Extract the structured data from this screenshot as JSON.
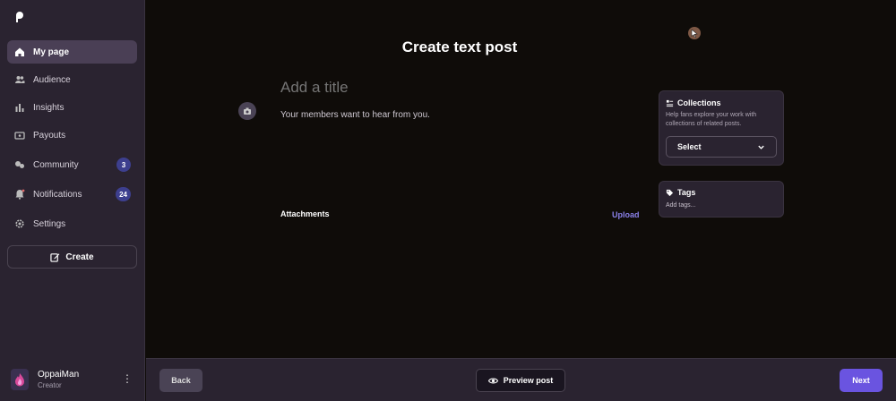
{
  "sidebar": {
    "items": [
      {
        "label": "My page",
        "icon": "home-icon",
        "active": true
      },
      {
        "label": "Audience",
        "icon": "people-icon"
      },
      {
        "label": "Insights",
        "icon": "bar-chart-icon"
      },
      {
        "label": "Payouts",
        "icon": "wallet-icon"
      },
      {
        "label": "Community",
        "icon": "community-icon",
        "badge": "3"
      },
      {
        "label": "Notifications",
        "icon": "bell-icon",
        "badge": "24"
      },
      {
        "label": "Settings",
        "icon": "gear-icon"
      }
    ],
    "create_label": "Create"
  },
  "profile": {
    "name": "OppaiMan",
    "role": "Creator"
  },
  "editor": {
    "page_title": "Create text post",
    "title_placeholder": "Add a title",
    "body_placeholder": "Your members want to hear from you.",
    "attachments_label": "Attachments",
    "upload_label": "Upload"
  },
  "collections": {
    "title": "Collections",
    "description": "Help fans explore your work with collections of related posts.",
    "select_value": "Select"
  },
  "tags": {
    "title": "Tags",
    "placeholder": "Add tags..."
  },
  "footer": {
    "back_label": "Back",
    "preview_label": "Preview post",
    "next_label": "Next"
  },
  "colors": {
    "accent": "#6a54e0",
    "upload_link": "#8a80e8",
    "badge": "#3d3f8e"
  }
}
